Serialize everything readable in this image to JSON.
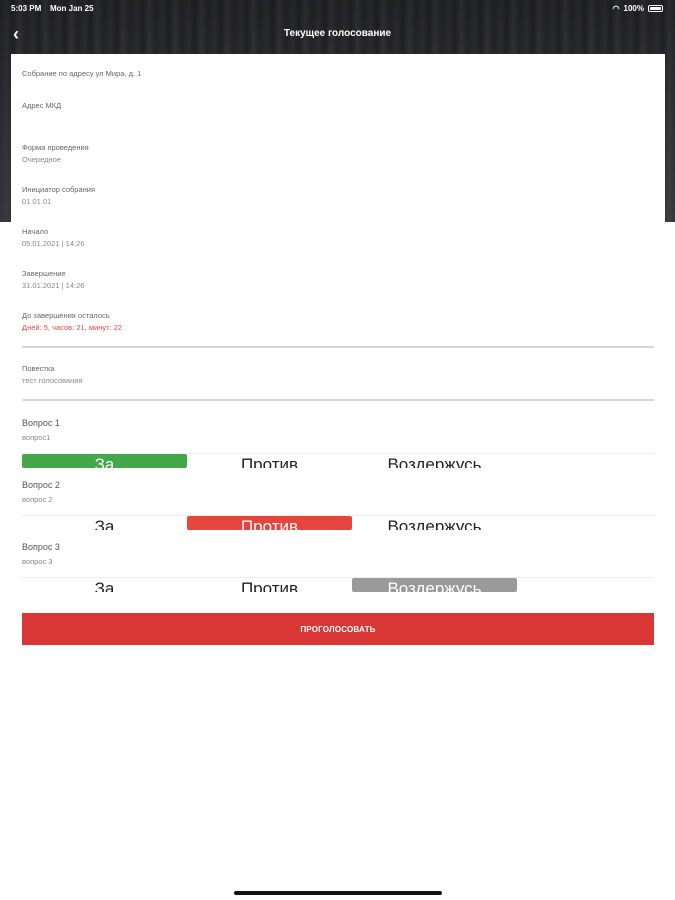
{
  "status_bar": {
    "time": "5:03 PM",
    "date": "Mon Jan 25",
    "battery": "100%"
  },
  "nav": {
    "title": "Текущее голосование"
  },
  "meeting": {
    "heading": "Собрание по адресу ул Мира, д. 1",
    "address_label": "Адрес МКД",
    "address_value": "",
    "form_label": "Форма проведения",
    "form_value": "Очередное",
    "initiator_label": "Инициатор собрания",
    "initiator_value": "01 01 01",
    "start_label": "Начало",
    "start_value": "05.01.2021 | 14:26",
    "end_label": "Завершение",
    "end_value": "31.01.2021 | 14:26",
    "remaining_label": "До завершения осталось",
    "remaining_value": "Дней: 5, часов: 21, минут: 22",
    "agenda_label": "Повестка",
    "agenda_value": "тест голосования"
  },
  "questions": [
    {
      "title": "Вопрос 1",
      "subtitle": "вопрос1",
      "options": [
        "За",
        "Против",
        "Воздержусь"
      ],
      "selected": "За"
    },
    {
      "title": "Вопрос 2",
      "subtitle": "вопрос 2",
      "options": [
        "За",
        "Против",
        "Воздержусь"
      ],
      "selected": "Против"
    },
    {
      "title": "Вопрос 3",
      "subtitle": "вопрос 3",
      "options": [
        "За",
        "Против",
        "Воздержусь"
      ],
      "selected": "Воздержусь"
    }
  ],
  "vote_button": {
    "label": "ПРОГОЛОСОВАТЬ"
  },
  "colors": {
    "accent_red": "#d93636",
    "selected_for": "#44a84a",
    "selected_against": "#e5453c",
    "selected_abstain": "#9a9a9a",
    "remaining_text": "#e0474c"
  }
}
